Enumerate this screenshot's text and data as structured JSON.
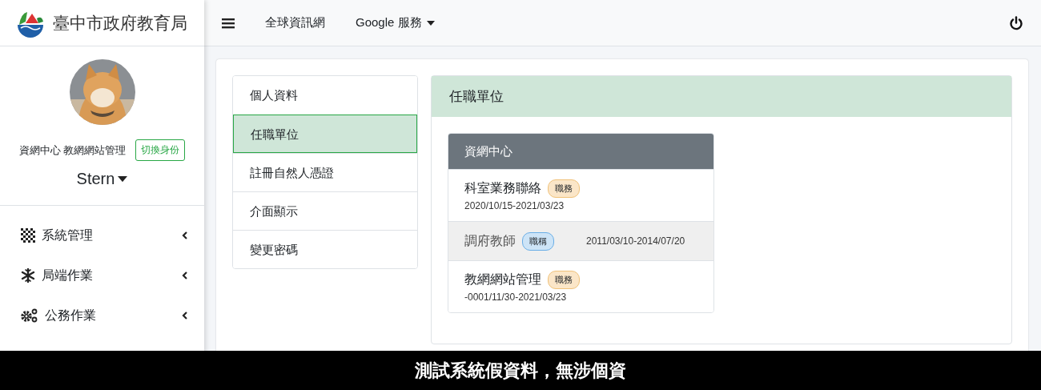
{
  "brand": {
    "title": "臺中市政府教育局"
  },
  "user": {
    "unit": "資網中心 教網網站管理",
    "switch_button": "切換身份",
    "name": "Stern"
  },
  "sidebar": {
    "items": [
      {
        "label": "系統管理",
        "kind": "grid",
        "expanded": false
      },
      {
        "label": "局端作業",
        "kind": "snowflake",
        "expanded": false
      },
      {
        "label": "公務作業",
        "kind": "cogs",
        "expanded": false
      }
    ]
  },
  "topbar": {
    "links": [
      {
        "label": "全球資訊網",
        "dropdown": false
      },
      {
        "label": "Google 服務",
        "dropdown": true
      }
    ]
  },
  "settings_menu": [
    {
      "label": "個人資料",
      "selected": false
    },
    {
      "label": "任職單位",
      "selected": true
    },
    {
      "label": "註冊自然人憑證",
      "selected": false
    },
    {
      "label": "介面顯示",
      "selected": false
    },
    {
      "label": "變更密碼",
      "selected": false
    }
  ],
  "panel": {
    "title": "任職單位",
    "units": [
      {
        "name": "資網中心",
        "positions": [
          {
            "title": "科室業務聯絡",
            "badge": {
              "label": "職務",
              "kind": "duty"
            },
            "period": "2020/10/15-2021/03/23",
            "highlighted": false
          },
          {
            "title": "調府教師",
            "badge": {
              "label": "職稱",
              "kind": "title"
            },
            "period": "2011/03/10-2014/07/20",
            "highlighted": true
          },
          {
            "title": "教網網站管理",
            "badge": {
              "label": "職務",
              "kind": "duty"
            },
            "period": "-0001/11/30-2021/03/23",
            "highlighted": false
          }
        ]
      }
    ]
  },
  "caption": "測試系統假資料，無涉個資"
}
